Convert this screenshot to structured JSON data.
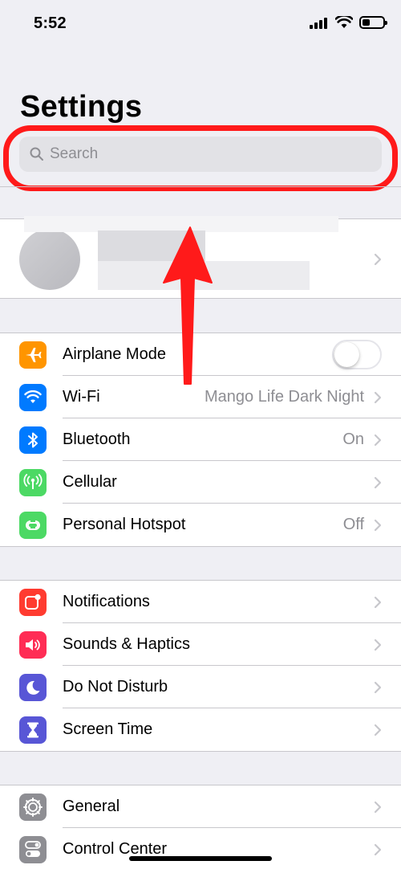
{
  "status_bar": {
    "time": "5:52"
  },
  "header": {
    "title": "Settings"
  },
  "search": {
    "placeholder": "Search"
  },
  "colors": {
    "annotation": "#ff1a1a",
    "airplane": "#ff9500",
    "wifi": "#007aff",
    "bluetooth": "#007aff",
    "cellular": "#4cd964",
    "hotspot": "#4cd964",
    "notifications": "#ff3b30",
    "sounds": "#ff2d55",
    "do_not_disturb": "#5856d6",
    "screen_time": "#5856d6",
    "general": "#8e8e93",
    "control_center": "#8e8e93"
  },
  "groups": [
    {
      "rows": [
        {
          "label": "Airplane Mode",
          "icon": "airplane-icon",
          "control": "toggle",
          "toggle_on": false
        },
        {
          "label": "Wi-Fi",
          "icon": "wifi-icon",
          "value": "Mango Life Dark Night"
        },
        {
          "label": "Bluetooth",
          "icon": "bluetooth-icon",
          "value": "On"
        },
        {
          "label": "Cellular",
          "icon": "cellular-icon",
          "value": ""
        },
        {
          "label": "Personal Hotspot",
          "icon": "hotspot-icon",
          "value": "Off"
        }
      ]
    },
    {
      "rows": [
        {
          "label": "Notifications",
          "icon": "notifications-icon"
        },
        {
          "label": "Sounds & Haptics",
          "icon": "sounds-icon"
        },
        {
          "label": "Do Not Disturb",
          "icon": "moon-icon"
        },
        {
          "label": "Screen Time",
          "icon": "hourglass-icon"
        }
      ]
    },
    {
      "rows": [
        {
          "label": "General",
          "icon": "gear-icon"
        },
        {
          "label": "Control Center",
          "icon": "toggles-icon"
        }
      ]
    }
  ]
}
